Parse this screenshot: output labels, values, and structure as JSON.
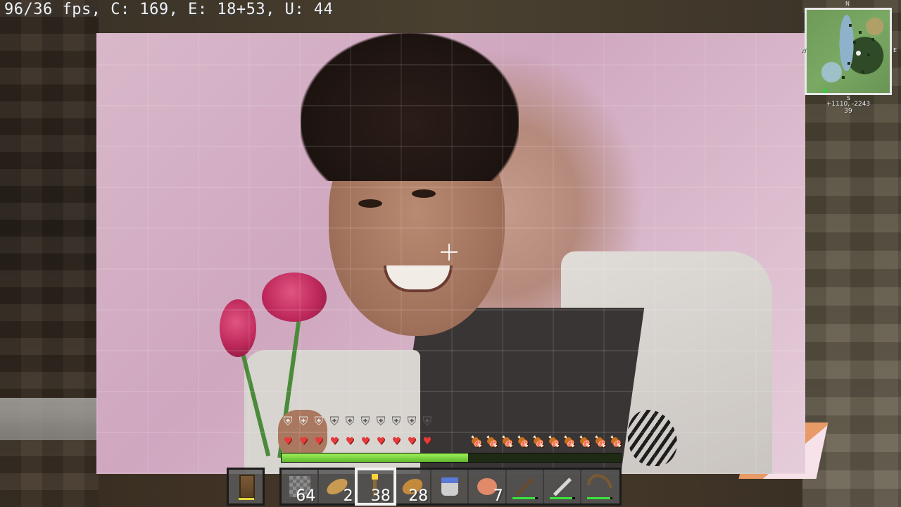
{
  "debug": {
    "text": "96/36 fps, C: 169, E: 18+53, U: 44"
  },
  "minimap": {
    "compass": {
      "n": "N",
      "s": "S",
      "e": "E",
      "w": "W"
    },
    "coords": "+1110, -2243",
    "y_level": "39"
  },
  "hud": {
    "armor": {
      "filled": 3,
      "total": 10
    },
    "health": {
      "hearts": 10,
      "max": 10
    },
    "hunger": {
      "full": 8,
      "half": 1,
      "empty": 1
    },
    "xp_progress": 0.55
  },
  "offhand": {
    "item": "oak-door-icon"
  },
  "hotbar": {
    "selected_index": 2,
    "slots": [
      {
        "item": "cobblestone-icon",
        "count": "64"
      },
      {
        "item": "bread-icon",
        "count": "2"
      },
      {
        "item": "torch-icon",
        "count": "38"
      },
      {
        "item": "baked-potato-icon",
        "count": "28"
      },
      {
        "item": "water-bucket-icon",
        "count": ""
      },
      {
        "item": "cooked-chicken-icon",
        "count": "7"
      },
      {
        "item": "pickaxe-icon",
        "count": ""
      },
      {
        "item": "iron-sword-icon",
        "count": ""
      },
      {
        "item": "bow-icon",
        "count": ""
      }
    ]
  },
  "colors": {
    "xp": "#7fd64a",
    "heart": "#e53b3b",
    "food": "#8a3a2a",
    "durability": "#3ae33a"
  }
}
